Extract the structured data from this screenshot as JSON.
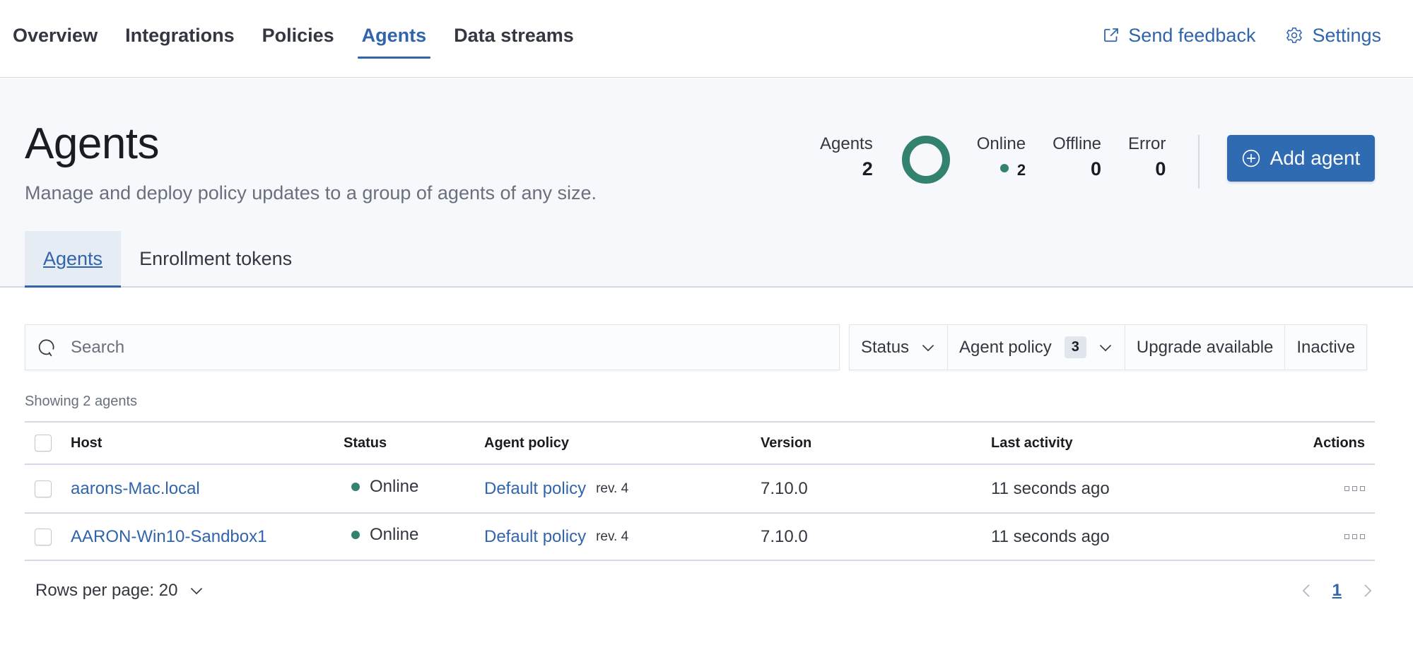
{
  "topnav": {
    "tabs": [
      {
        "label": "Overview",
        "active": false
      },
      {
        "label": "Integrations",
        "active": false
      },
      {
        "label": "Policies",
        "active": false
      },
      {
        "label": "Agents",
        "active": true
      },
      {
        "label": "Data streams",
        "active": false
      }
    ],
    "send_feedback": {
      "label": "Send feedback",
      "icon": "external-link-icon"
    },
    "settings": {
      "label": "Settings",
      "icon": "gear-icon"
    }
  },
  "header": {
    "title": "Agents",
    "description": "Manage and deploy policy updates to a group of agents of any size.",
    "stats": {
      "agents": {
        "label": "Agents",
        "value": "2"
      },
      "online": {
        "label": "Online",
        "value": "2"
      },
      "offline": {
        "label": "Offline",
        "value": "0"
      },
      "error": {
        "label": "Error",
        "value": "0"
      }
    },
    "donut": {
      "online_fraction": 1.0,
      "color": "#33826f"
    },
    "add_agent_label": "Add agent",
    "subtabs": [
      {
        "label": "Agents",
        "active": true
      },
      {
        "label": "Enrollment tokens",
        "active": false
      }
    ]
  },
  "search": {
    "placeholder": "Search",
    "value": ""
  },
  "filters": {
    "status": "Status",
    "agent_policy": "Agent policy",
    "agent_policy_count": "3",
    "upgrade_available": "Upgrade available",
    "inactive": "Inactive"
  },
  "showing_label": "Showing 2 agents",
  "table": {
    "columns": {
      "host": "Host",
      "status": "Status",
      "policy": "Agent policy",
      "version": "Version",
      "activity": "Last activity",
      "actions": "Actions"
    },
    "rows": [
      {
        "host": "aarons-Mac.local",
        "status": "Online",
        "policy": "Default policy",
        "rev": "rev. 4",
        "version": "7.10.0",
        "activity": "11 seconds ago"
      },
      {
        "host": "AARON-Win10-Sandbox1",
        "status": "Online",
        "policy": "Default policy",
        "rev": "rev. 4",
        "version": "7.10.0",
        "activity": "11 seconds ago"
      }
    ]
  },
  "footer": {
    "rows_per_page": "Rows per page: 20",
    "current_page": "1"
  },
  "colors": {
    "accent": "#3165ab",
    "primary_button": "#2f6bb3",
    "success": "#33826f"
  }
}
